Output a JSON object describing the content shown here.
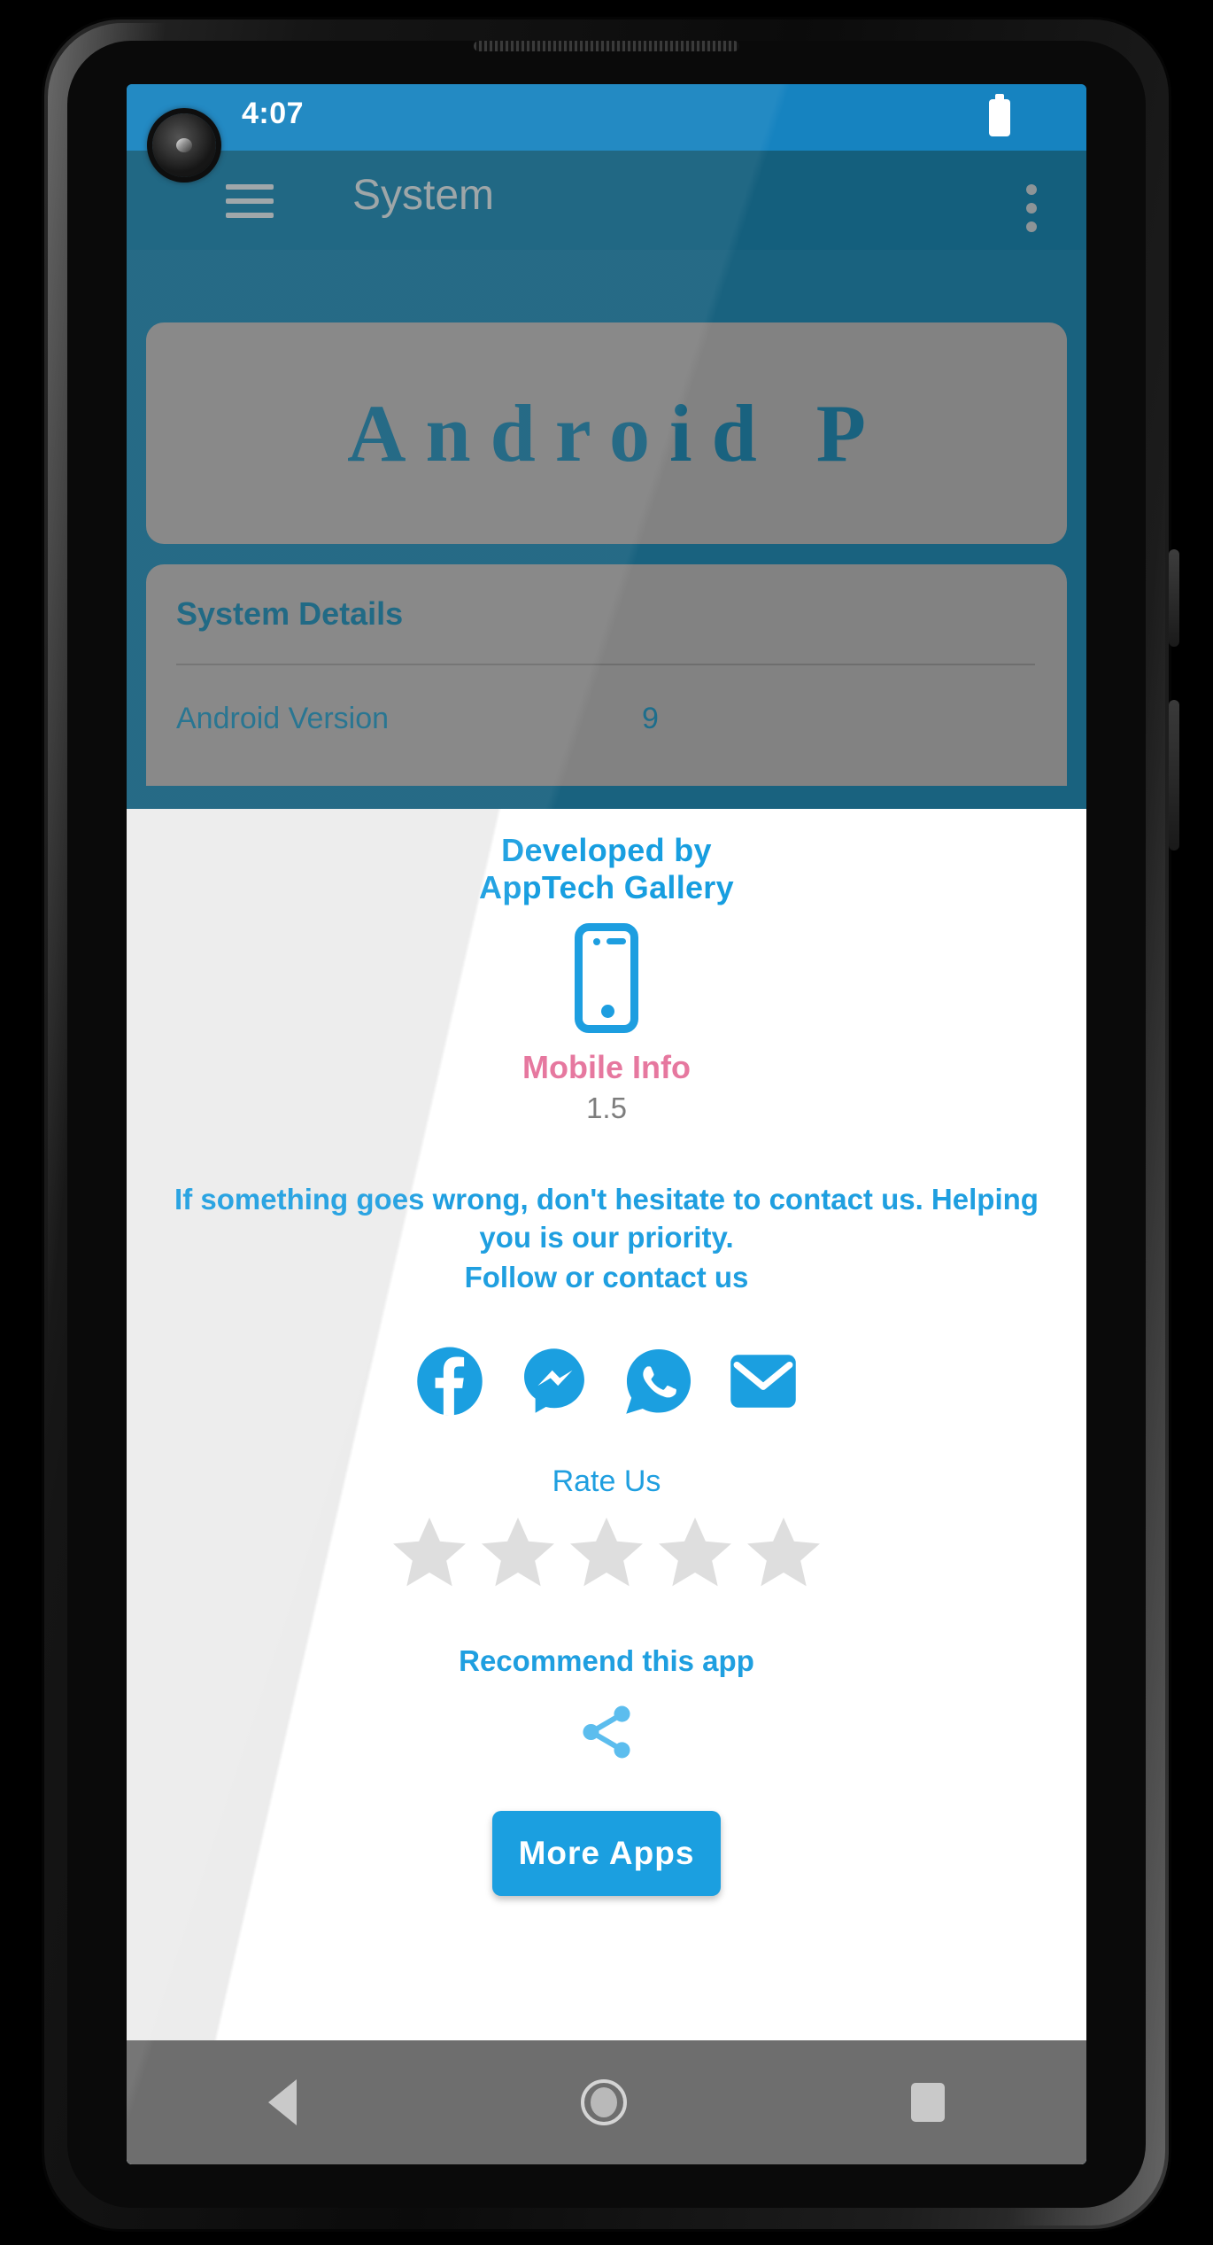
{
  "status_bar": {
    "time": "4:07",
    "battery_icon": "battery-full-icon"
  },
  "app_bar": {
    "menu_icon": "hamburger-menu-icon",
    "title": "System",
    "overflow_icon": "overflow-menu-icon"
  },
  "background": {
    "version_card": {
      "title": "Android P"
    },
    "details_card": {
      "title": "System Details",
      "rows": [
        {
          "label": "Android Version",
          "value": "9"
        }
      ]
    }
  },
  "dialog": {
    "developed_by": {
      "line1": "Developed by",
      "line2": "AppTech Gallery"
    },
    "logo_icon": "mobile-phone-icon",
    "app_name": "Mobile Info",
    "app_version": "1.5",
    "contact_message": "If something goes wrong, don't hesitate to contact us. Helping you is our priority.",
    "follow_line": "Follow or contact us",
    "social": [
      {
        "name": "facebook-icon",
        "label": "Facebook"
      },
      {
        "name": "messenger-icon",
        "label": "Messenger"
      },
      {
        "name": "whatsapp-icon",
        "label": "WhatsApp"
      },
      {
        "name": "email-icon",
        "label": "Email"
      }
    ],
    "rate_us_label": "Rate Us",
    "rating": {
      "max": 5,
      "value": 0
    },
    "recommend_label": "Recommend this app",
    "share_icon": "share-icon",
    "more_apps_label": "More Apps"
  },
  "nav_bar": {
    "back": "back-triangle-icon",
    "home": "home-circle-icon",
    "recents": "recents-square-icon"
  },
  "colors": {
    "status_bar": "#1683c0",
    "app_bar": "#145f7d",
    "page_background": "#19627f",
    "card": "#828282",
    "accent_blue": "#1b9fe0",
    "app_name_pink": "#e6789f",
    "star_empty": "#dedede",
    "nav_bar": "#6e6e6e"
  }
}
